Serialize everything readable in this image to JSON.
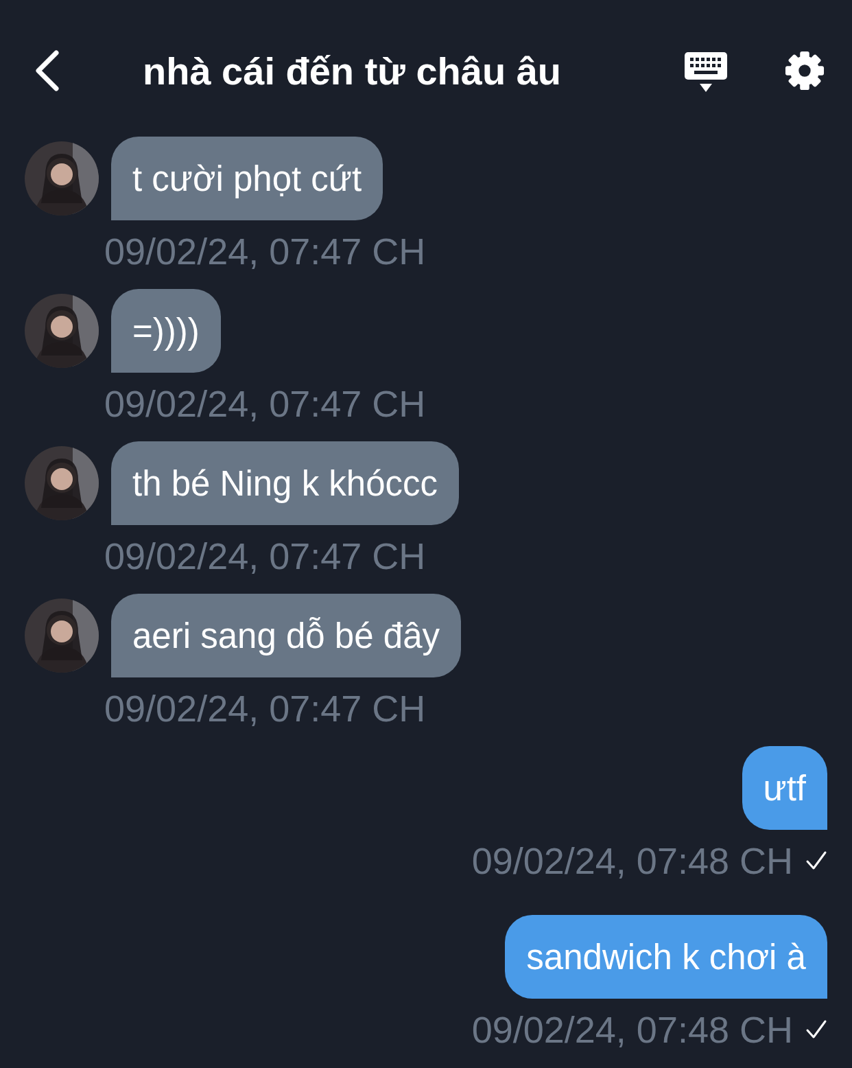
{
  "header": {
    "title": "nhà cái đến từ châu âu"
  },
  "messages": [
    {
      "kind": "incoming",
      "text": "t cười phọt cứt",
      "time": "09/02/24, 07:47 CH"
    },
    {
      "kind": "incoming",
      "text": "=))))",
      "time": "09/02/24, 07:47 CH"
    },
    {
      "kind": "incoming",
      "text": "th bé Ning k khóccc",
      "time": "09/02/24, 07:47 CH"
    },
    {
      "kind": "incoming",
      "text": "aeri sang dỗ bé đây",
      "time": "09/02/24, 07:47 CH"
    },
    {
      "kind": "outgoing",
      "text": "ưtf",
      "time": "09/02/24, 07:48 CH",
      "delivered": true
    },
    {
      "kind": "outgoing",
      "text": "sandwich k chơi à",
      "time": "09/02/24, 07:48 CH",
      "delivered": true
    }
  ]
}
